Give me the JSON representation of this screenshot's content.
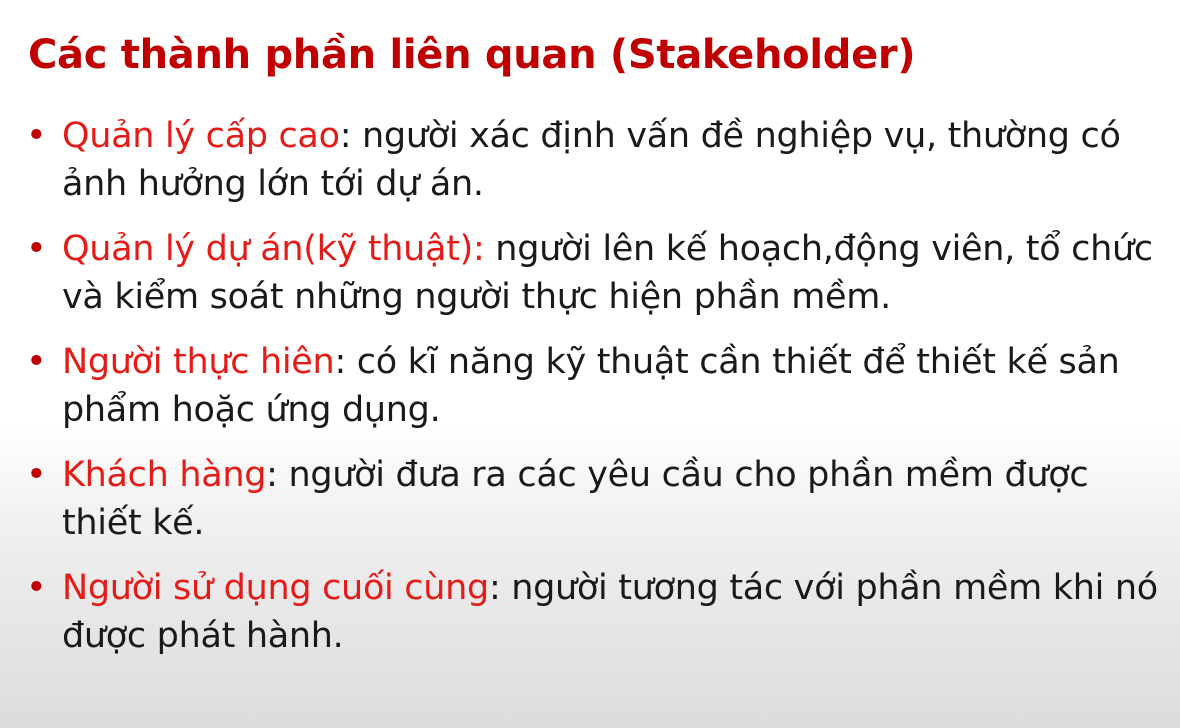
{
  "title": "Các thành phần liên quan (Stakeholder)",
  "bullet_symbol": "•",
  "items": [
    {
      "term": "Quản lý cấp cao",
      "desc": ": người xác định vấn đề nghiệp vụ, thường có ảnh hưởng lớn tới dự án."
    },
    {
      "term": "Quản lý dự án(kỹ thuật):",
      "desc": " người lên kế hoạch,động viên, tổ chức và kiểm soát những người thực hiện phần mềm."
    },
    {
      "term": "Người thực hiên",
      "desc": ": có kĩ năng kỹ thuật cần thiết để  thiết kế sản phẩm hoặc ứng dụng."
    },
    {
      "term": "Khách hàng",
      "desc": ": người đưa ra các yêu cầu cho phần mềm được thiết kế."
    },
    {
      "term": "Người sử dụng cuối cùng",
      "desc": ": người tương tác với phần mềm khi nó được phát hành."
    }
  ],
  "colors": {
    "title": "#c00000",
    "term": "#e41b17",
    "text": "#1a1a1a"
  }
}
